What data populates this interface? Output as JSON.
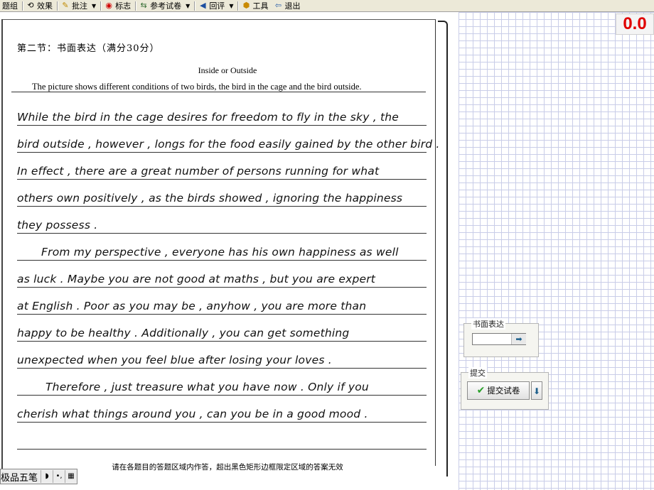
{
  "toolbar": {
    "items": [
      {
        "label": "题组",
        "icon": "group-icon"
      },
      {
        "label": "效果",
        "icon": "effect-icon"
      },
      {
        "label": "批注",
        "icon": "pencil-icon",
        "dropdown": true
      },
      {
        "label": "标志",
        "icon": "mark-icon"
      },
      {
        "label": "参考试卷",
        "icon": "reference-icon",
        "dropdown": true
      },
      {
        "label": "回评",
        "icon": "back-arrow-icon",
        "dropdown": true
      },
      {
        "label": "工具",
        "icon": "tools-icon"
      },
      {
        "label": "退出",
        "icon": "exit-icon"
      }
    ]
  },
  "score": "0.0",
  "sheet": {
    "section_title": "第二节：书面表达（满分30分）",
    "essay_title": "Inside or Outside",
    "prompt": "The picture shows different conditions of two birds, the bird in the cage and the bird outside.",
    "lines": [
      "While the bird in the cage desires for freedom to fly in the sky , the",
      "bird outside , however , longs for the food easily gained by the other bird .",
      "In effect , there are a great number of persons running for what",
      "others own positively , as the birds showed , ignoring the happiness",
      "they possess .",
      "From my perspective , everyone has his own happiness as well",
      "as luck . Maybe you are not good at maths , but you are expert",
      "at English . Poor as you may be , anyhow , you are more than",
      "happy to be healthy . Additionally , you can get something",
      "unexpected when you feel blue after losing your loves .",
      "Therefore , just treasure what you have now . Only if you",
      "cherish what things around you , can you be in a good mood .",
      ""
    ],
    "footer_note": "请在各题目的答题区域内作答，超出黑色矩形边框限定区域的答案无效"
  },
  "panels": {
    "writing": {
      "legend": "书面表达",
      "value": ""
    },
    "submit": {
      "legend": "提交",
      "button_label": "提交试卷"
    }
  },
  "ime": {
    "label": "极品五笔"
  }
}
